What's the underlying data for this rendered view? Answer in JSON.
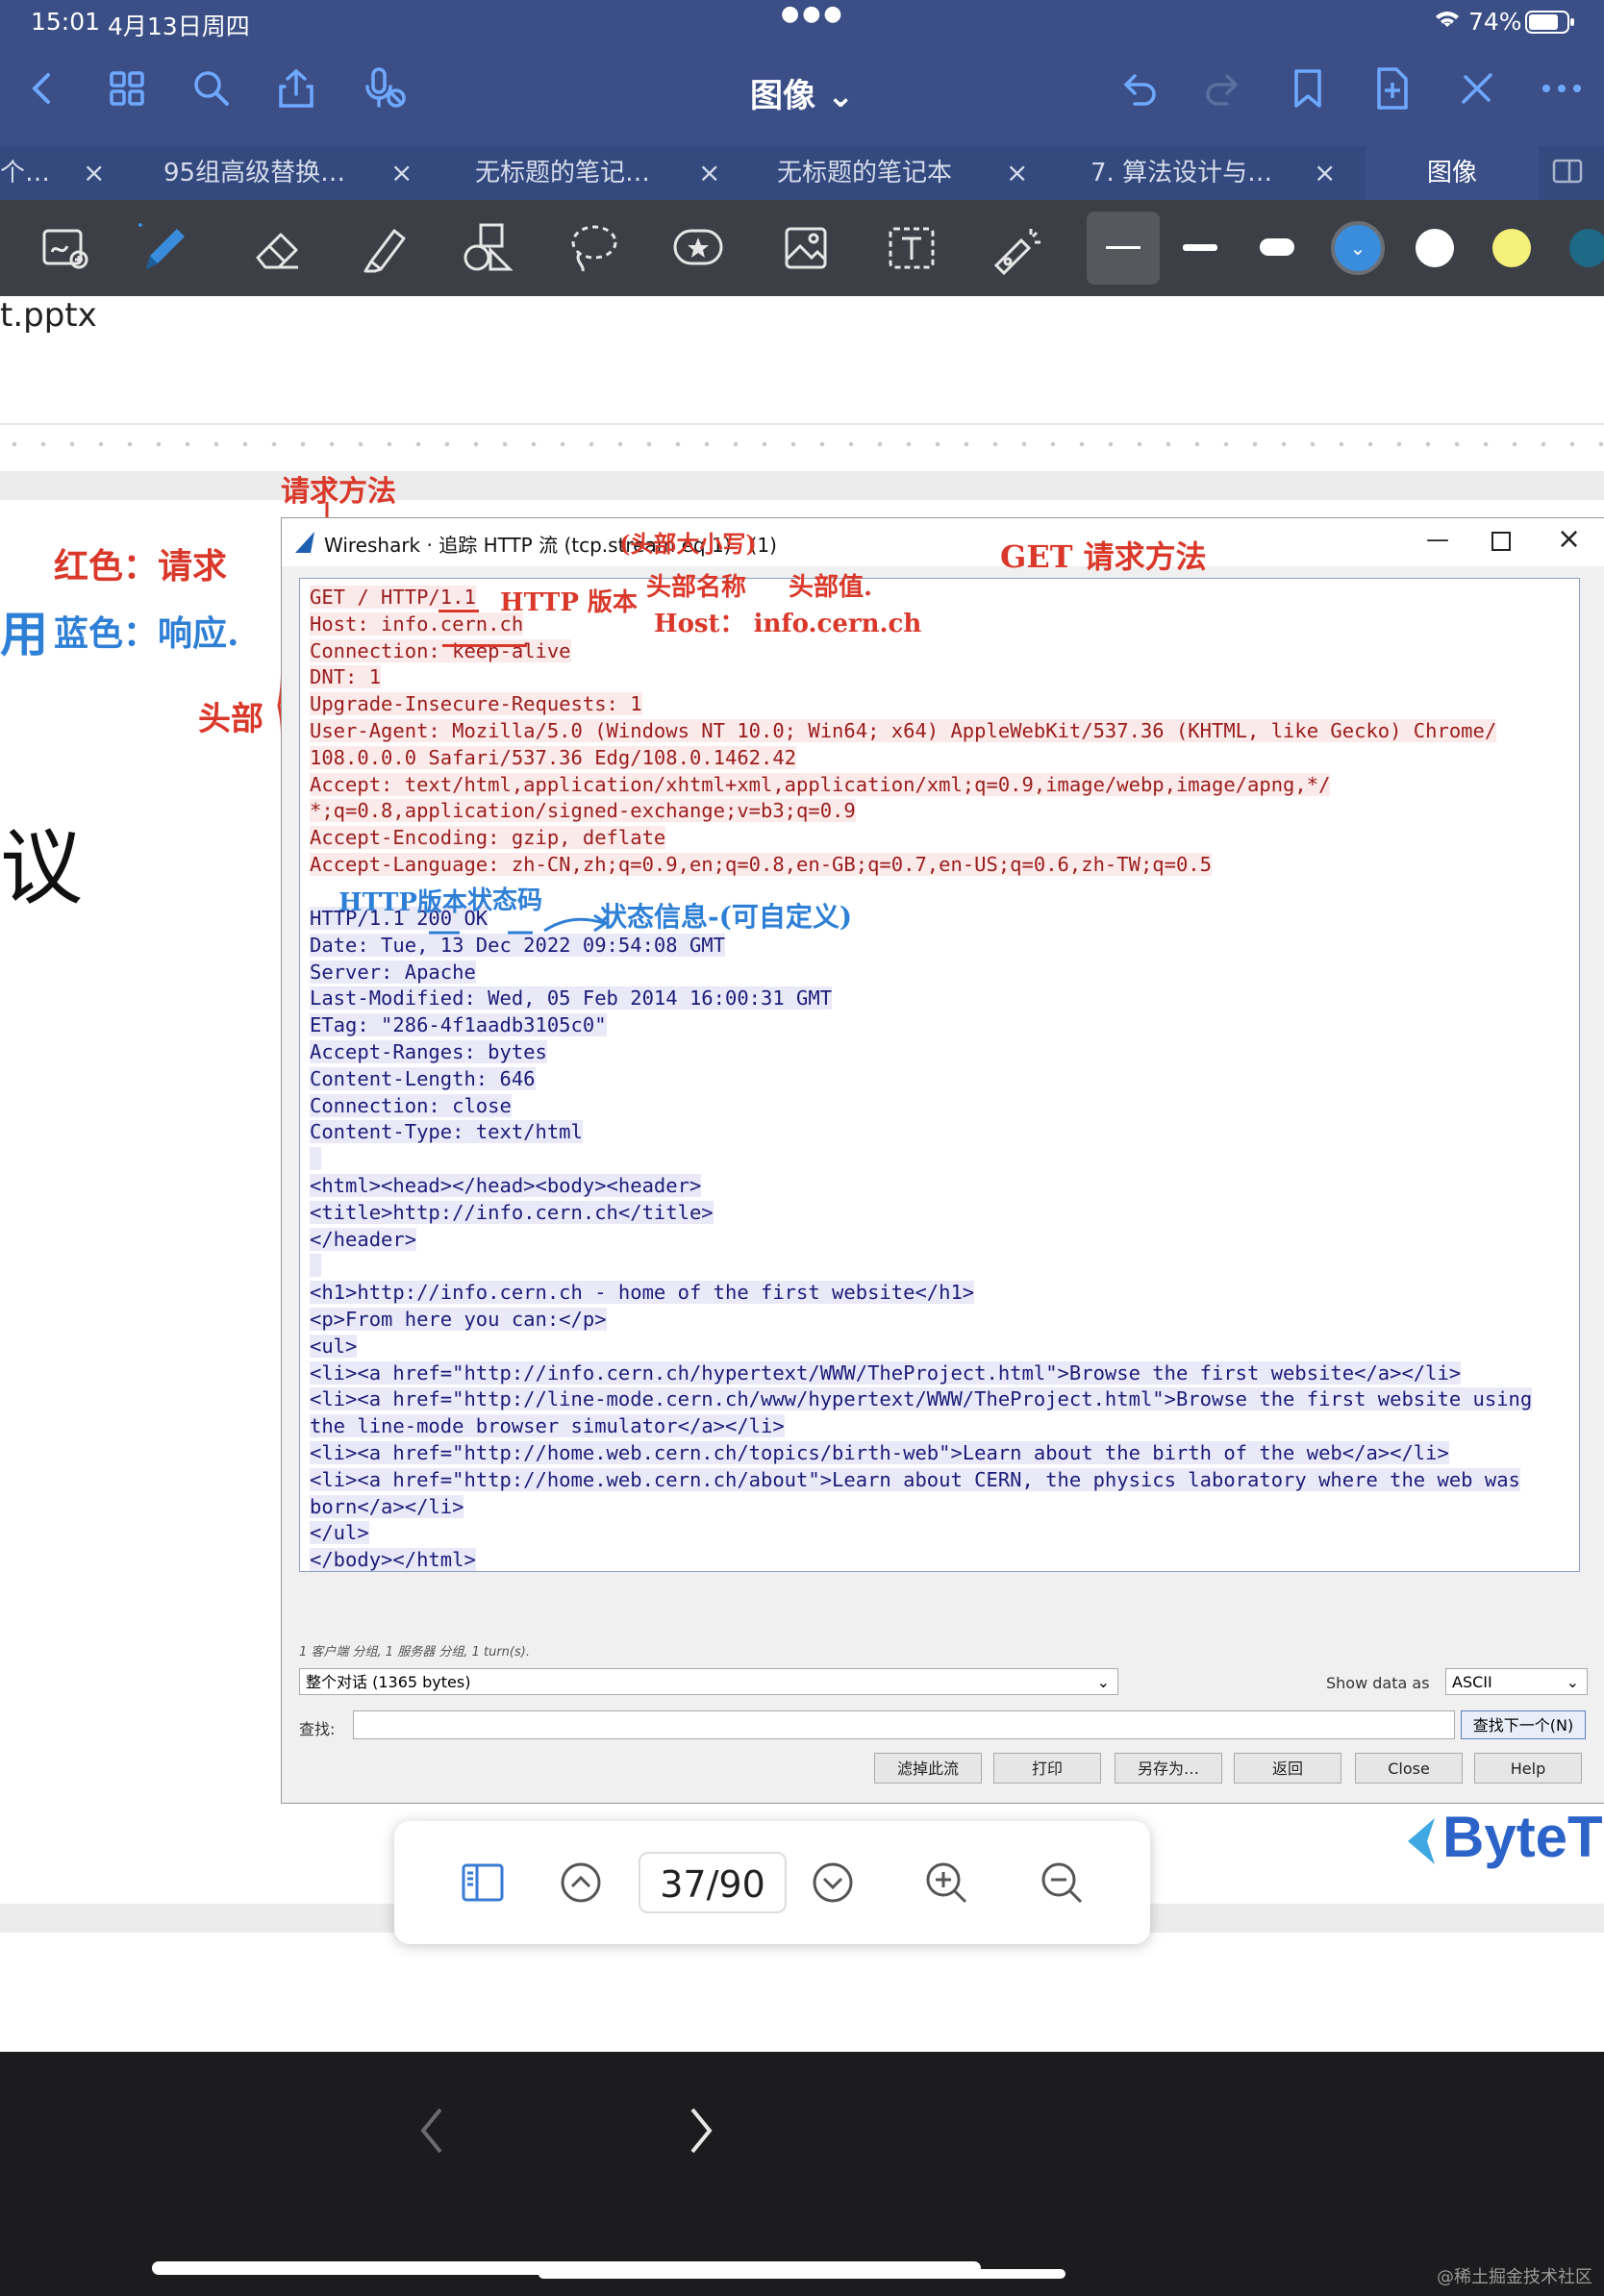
{
  "status_bar": {
    "time": "15:01",
    "date": "4月13日周四",
    "battery": "74%"
  },
  "app_bar": {
    "title": "图像 ⌄"
  },
  "tabs": [
    {
      "label": "个…"
    },
    {
      "label": "95组高级替换…"
    },
    {
      "label": "无标题的笔记…"
    },
    {
      "label": "无标题的笔记本"
    },
    {
      "label": "7. 算法设计与…"
    },
    {
      "label": "图像"
    }
  ],
  "toolbar": {
    "accent": "#3a8ddc"
  },
  "page": {
    "file_name": "t.pptx",
    "left_big_char": "议"
  },
  "annotations": {
    "request_method": "请求方法",
    "red_means": "红色：请求",
    "blue_means": "蓝色：响应.",
    "blue_left": "用",
    "http_version_red": "HTTP 版本",
    "header_name": "头部名称",
    "header_value": "头部值.",
    "host_note": "Host： info.cern.ch",
    "get_note": "GET 请求方法",
    "head_label": "头部",
    "title_note": "(头部大小写)",
    "http_version_blue": "HTTP版本",
    "status_code": "状态码",
    "status_msg": "状态信息-(可自定义)"
  },
  "wireshark": {
    "title": "Wireshark · 追踪 HTTP 流 (tcp.stream eq 1) · (1)",
    "request_lines": [
      "GET / HTTP/1.1",
      "Host: info.cern.ch",
      "Connection: keep-alive",
      "DNT: 1",
      "Upgrade-Insecure-Requests: 1",
      "User-Agent: Mozilla/5.0 (Windows NT 10.0; Win64; x64) AppleWebKit/537.36 (KHTML, like Gecko) Chrome/",
      "108.0.0.0 Safari/537.36 Edg/108.0.1462.42",
      "Accept: text/html,application/xhtml+xml,application/xml;q=0.9,image/webp,image/apng,*/",
      "*;q=0.8,application/signed-exchange;v=b3;q=0.9",
      "Accept-Encoding: gzip, deflate",
      "Accept-Language: zh-CN,zh;q=0.9,en;q=0.8,en-GB;q=0.7,en-US;q=0.6,zh-TW;q=0.5"
    ],
    "response_lines": [
      "HTTP/1.1 200 OK",
      "Date: Tue, 13 Dec 2022 09:54:08 GMT",
      "Server: Apache",
      "Last-Modified: Wed, 05 Feb 2014 16:00:31 GMT",
      "ETag: \"286-4f1aadb3105c0\"",
      "Accept-Ranges: bytes",
      "Content-Length: 646",
      "Connection: close",
      "Content-Type: text/html",
      "",
      "<html><head></head><body><header>",
      "<title>http://info.cern.ch</title>",
      "</header>",
      "",
      "<h1>http://info.cern.ch - home of the first website</h1>",
      "<p>From here you can:</p>",
      "<ul>",
      "<li><a href=\"http://info.cern.ch/hypertext/WWW/TheProject.html\">Browse the first website</a></li>",
      "<li><a href=\"http://line-mode.cern.ch/www/hypertext/WWW/TheProject.html\">Browse the first website using",
      "the line-mode browser simulator</a></li>",
      "<li><a href=\"http://home.web.cern.ch/topics/birth-web\">Learn about the birth of the web</a></li>",
      "<li><a href=\"http://home.web.cern.ch/about\">Learn about CERN, the physics laboratory where the web was",
      "born</a></li>",
      "</ul>",
      "</body></html>"
    ],
    "summary": "1 客户端 分组, 1 服务器 分组, 1 turn(s).",
    "conversation": "整个对话 (1365 bytes)",
    "show_data_as_label": "Show data as",
    "encoding": "ASCII",
    "find_label": "查找:",
    "find_next": "查找下一个(N)",
    "buttons": [
      "滤掉此流",
      "打印",
      "另存为…",
      "返回",
      "Close",
      "Help"
    ]
  },
  "slide_logo": "ByteT",
  "page_nav": {
    "page": "37/90"
  },
  "site_watermark": "@稀土掘金技术社区"
}
